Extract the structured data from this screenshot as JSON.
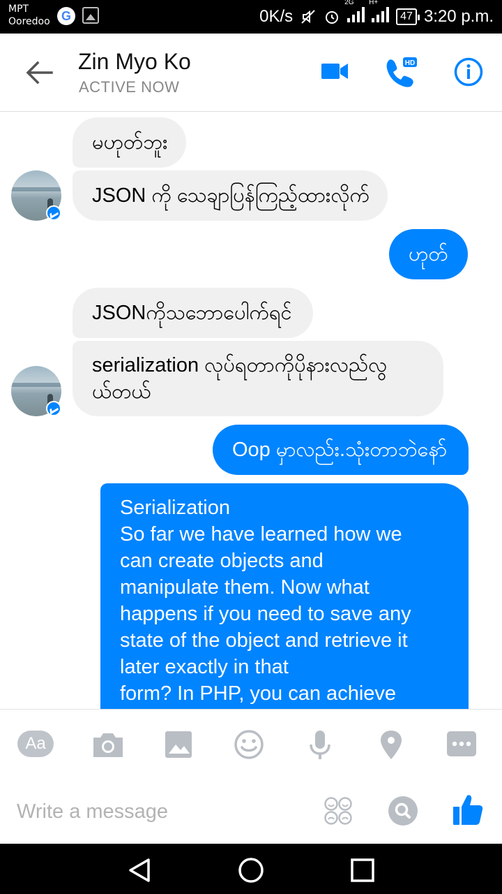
{
  "status_bar": {
    "carrier_line1": "MPT",
    "carrier_line2": "Ooredoo",
    "network_speed": "0K/s",
    "network_2g": "2G",
    "network_h": "H+",
    "battery": "47",
    "time": "3:20 p.m."
  },
  "header": {
    "contact_name": "Zin Myo Ko",
    "contact_status": "ACTIVE NOW"
  },
  "messages": [
    {
      "direction": "incoming",
      "text": "မဟုတ်ဘူး"
    },
    {
      "direction": "incoming",
      "text": "JSON ကို သေချာပြန်ကြည့်ထားလိုက်"
    },
    {
      "direction": "outgoing",
      "text": "ဟုတ်"
    },
    {
      "direction": "incoming",
      "text": "JSONကိုသဘောပေါက်ရင်"
    },
    {
      "direction": "incoming",
      "lines": [
        "serialization  လုပ်ရတာကိုပိုနားလည်လွ",
        "ယ်တယ်"
      ]
    },
    {
      "direction": "outgoing",
      "text": "Oop မှာလည်း.သုံးတာဘဲနော်"
    },
    {
      "direction": "outgoing",
      "lines": [
        "Serialization",
        "So far we have learned how we",
        "can create objects and",
        "manipulate them. Now what",
        "happens if you need to save any",
        "state of the object and retrieve it",
        "later exactly in that",
        "form? In PHP, you can achieve"
      ]
    }
  ],
  "composer": {
    "aa_label": "Aa",
    "placeholder": "Write a message"
  },
  "colors": {
    "accent": "#0084ff",
    "incoming_bubble": "#f1f0f0",
    "icon_gray": "#b9bec4"
  },
  "icons": {
    "back": "arrow-left-icon",
    "video": "video-camera-icon",
    "phone": "phone-hd-icon",
    "info": "info-icon",
    "camera": "camera-icon",
    "image": "image-icon",
    "emoji": "smiley-icon",
    "mic": "microphone-icon",
    "location": "location-pin-icon",
    "more": "more-icon",
    "stickers": "stickers-icon",
    "search": "search-icon",
    "like": "thumbs-up-icon"
  }
}
